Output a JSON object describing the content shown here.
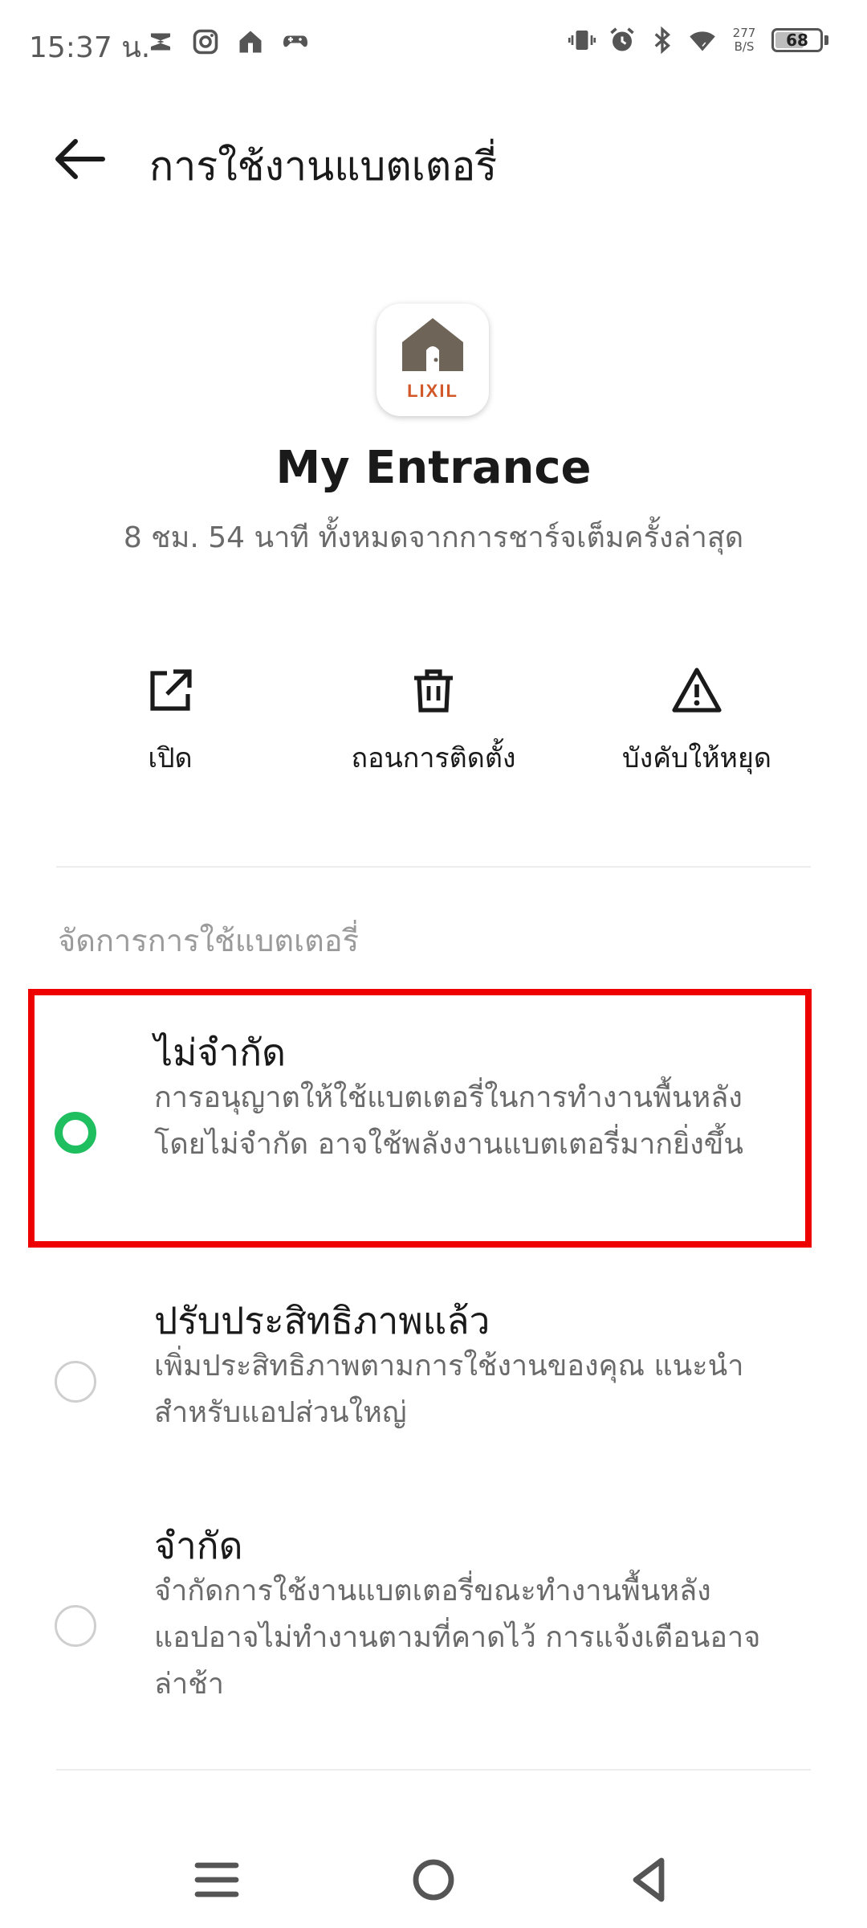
{
  "status_bar": {
    "time": "15:37 น.",
    "net_speed_value": "277",
    "net_speed_unit": "B/S",
    "battery_level": "68",
    "battery_fraction": 0.68
  },
  "header": {
    "title": "การใช้งานแบตเตอรี่"
  },
  "app": {
    "name": "My Entrance",
    "logo_text": "LIXIL",
    "usage_summary": "8 ชม. 54 นาที ทั้งหมดจากการชาร์จเต็มครั้งล่าสุด"
  },
  "actions": [
    {
      "label": "เปิด",
      "icon": "open-external-icon"
    },
    {
      "label": "ถอนการติดตั้ง",
      "icon": "trash-icon"
    },
    {
      "label": "บังคับให้หยุด",
      "icon": "warning-icon"
    }
  ],
  "section": {
    "title": "จัดการการใช้แบตเตอรี่"
  },
  "options": [
    {
      "title": "ไม่จำกัด",
      "description": "การอนุญาตให้ใช้แบตเตอรี่ในการทำงานพื้นหลังโดยไม่จำกัด อาจใช้พลังงานแบตเตอรี่มากยิ่งขึ้น",
      "selected": true
    },
    {
      "title": "ปรับประสิทธิภาพแล้ว",
      "description": "เพิ่มประสิทธิภาพตามการใช้งานของคุณ แนะนำสำหรับแอปส่วนใหญ่",
      "selected": false
    },
    {
      "title": "จำกัด",
      "description": "จำกัดการใช้งานแบตเตอรี่ขณะทำงานพื้นหลัง แอปอาจไม่ทำงานตามที่คาดไว้ การแจ้งเตือนอาจล่าช้า",
      "selected": false
    }
  ],
  "colors": {
    "accent": "#1fbe5f",
    "highlight": "#ee0000",
    "logo_house": "#6e6457",
    "logo_text": "#d2582a"
  }
}
